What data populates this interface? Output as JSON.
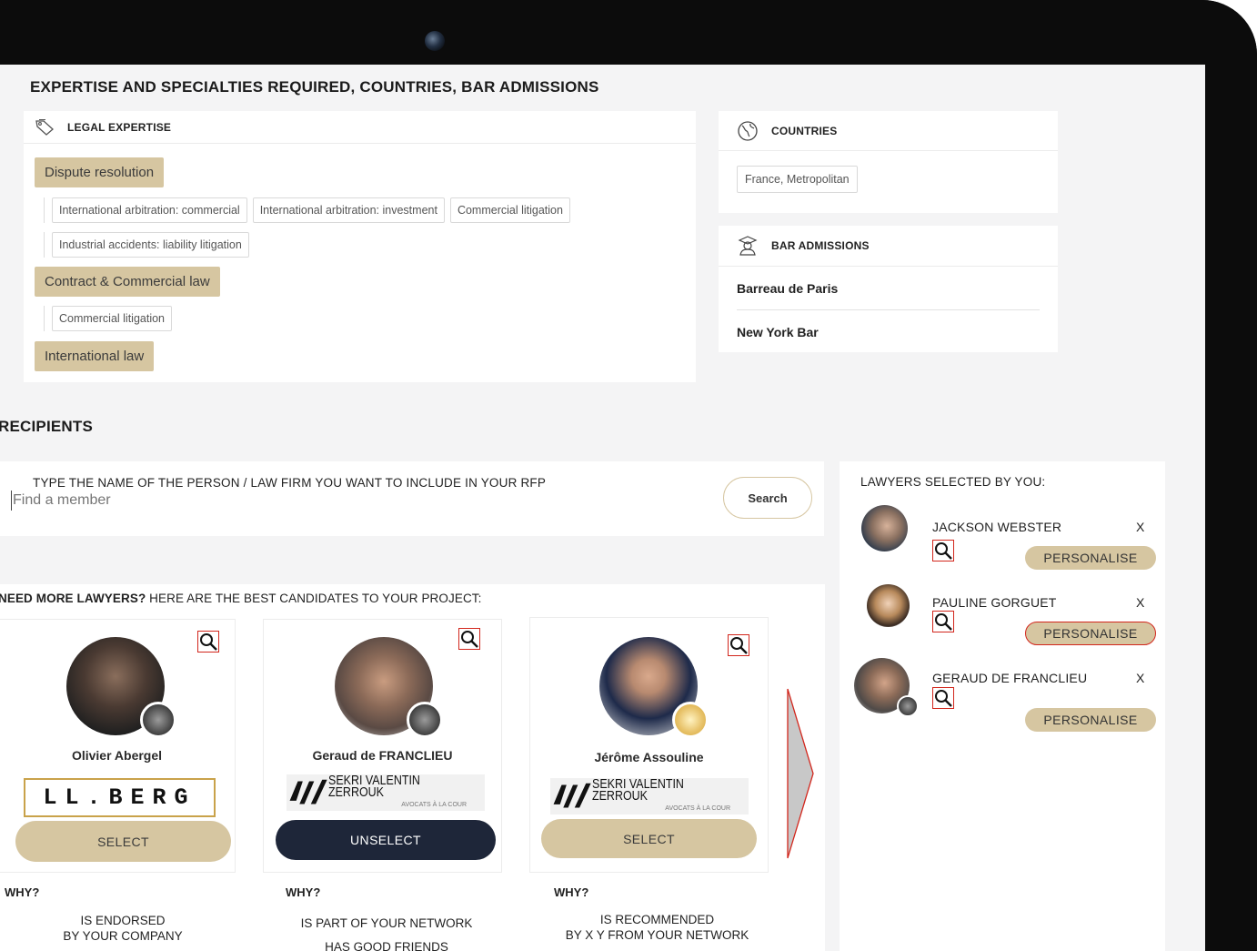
{
  "expertise": {
    "title": "EXPERTISE AND SPECIALTIES REQUIRED, COUNTRIES, BAR ADMISSIONS",
    "legal_header": "LEGAL EXPERTISE",
    "groups": [
      {
        "name": "Dispute resolution",
        "subs": [
          "International arbitration: commercial",
          "International arbitration: investment",
          "Commercial litigation",
          "Industrial accidents: liability litigation"
        ]
      },
      {
        "name": "Contract & Commercial law",
        "subs": [
          "Commercial litigation"
        ]
      },
      {
        "name": "International law",
        "subs": []
      }
    ],
    "countries_header": "COUNTRIES",
    "countries": [
      "France, Metropolitan"
    ],
    "bar_header": "BAR ADMISSIONS",
    "bars": [
      "Barreau de Paris",
      "New York Bar"
    ]
  },
  "recipients": {
    "title": "RECIPIENTS",
    "search_label": "TYPE THE NAME OF THE PERSON / LAW FIRM YOU WANT TO INCLUDE IN YOUR RFP",
    "search_placeholder": "Find a member",
    "search_button": "Search",
    "more_bold": "NEED MORE LAWYERS?",
    "more_text": " HERE ARE THE BEST CANDIDATES TO YOUR PROJECT:",
    "candidates": [
      {
        "name": "Olivier Abergel",
        "firm": "LL.BERG",
        "button": "SELECT",
        "why_label": "WHY?",
        "why": [
          "IS ENDORSED",
          "BY YOUR COMPANY"
        ]
      },
      {
        "name": "Geraud de FRANCLIEU",
        "firm": "SEKRI VALENTIN ZERROUK",
        "firm_sub": "AVOCATS À LA COUR",
        "button": "UNSELECT",
        "why_label": "WHY?",
        "why": [
          "IS PART OF YOUR NETWORK"
        ],
        "why_extra": "HAS GOOD FRIENDS"
      },
      {
        "name": "Jérôme Assouline",
        "firm": "SEKRI VALENTIN ZERROUK",
        "firm_sub": "AVOCATS À LA COUR",
        "button": "SELECT",
        "why_label": "WHY?",
        "why": [
          "IS RECOMMENDED",
          "BY X Y FROM YOUR NETWORK"
        ]
      }
    ],
    "selected_title": "LAWYERS SELECTED BY  YOU:",
    "selected": [
      {
        "name": "JACKSON WEBSTER",
        "remove": "X",
        "button": "PERSONALISE"
      },
      {
        "name": "PAULINE GORGUET",
        "remove": "X",
        "button": "PERSONALISE"
      },
      {
        "name": "GERAUD DE FRANCLIEU",
        "remove": "X",
        "button": "PERSONALISE"
      }
    ]
  },
  "colors": {
    "accent": "#d6c6a1",
    "dark": "#1e2639",
    "highlight": "#d2261c"
  }
}
